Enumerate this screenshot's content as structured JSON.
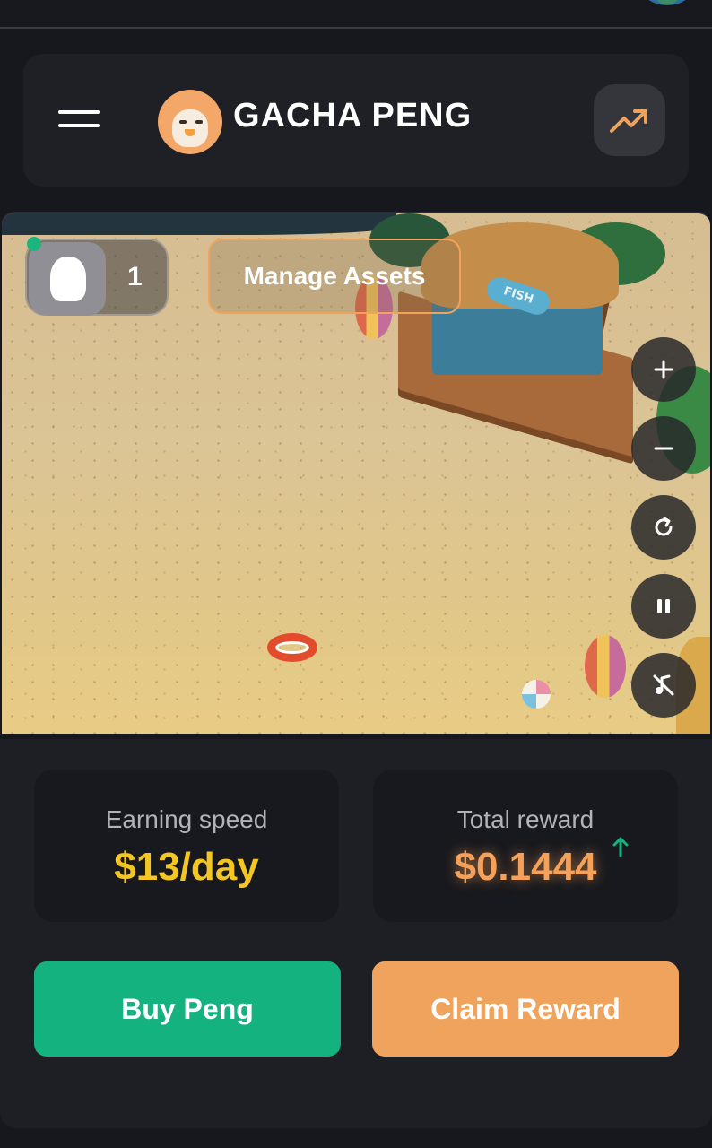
{
  "header": {
    "title": "GACHA PENG",
    "menu_icon": "hamburger-menu-icon",
    "logo_icon": "penguin-logo-icon",
    "stats_icon": "trending-up-icon"
  },
  "game": {
    "owner_count": "1",
    "owner_icon": "penguin-silhouette-icon",
    "manage_assets_label": "Manage Assets",
    "shop_sign": "FISH",
    "controls": [
      "zoom-in-icon",
      "zoom-out-icon",
      "refresh-icon",
      "pause-icon",
      "music-off-icon"
    ]
  },
  "stats": {
    "earning_speed_label": "Earning speed",
    "earning_speed_value": "$13/day",
    "total_reward_label": "Total reward",
    "total_reward_value": "$0.1444"
  },
  "actions": {
    "buy_label": "Buy Peng",
    "claim_label": "Claim Reward"
  },
  "colors": {
    "background": "#17181d",
    "accent_orange": "#f0a35c",
    "accent_green": "#13b27e",
    "speed_yellow": "#f3c623",
    "reward_orange": "#f5a15a"
  }
}
